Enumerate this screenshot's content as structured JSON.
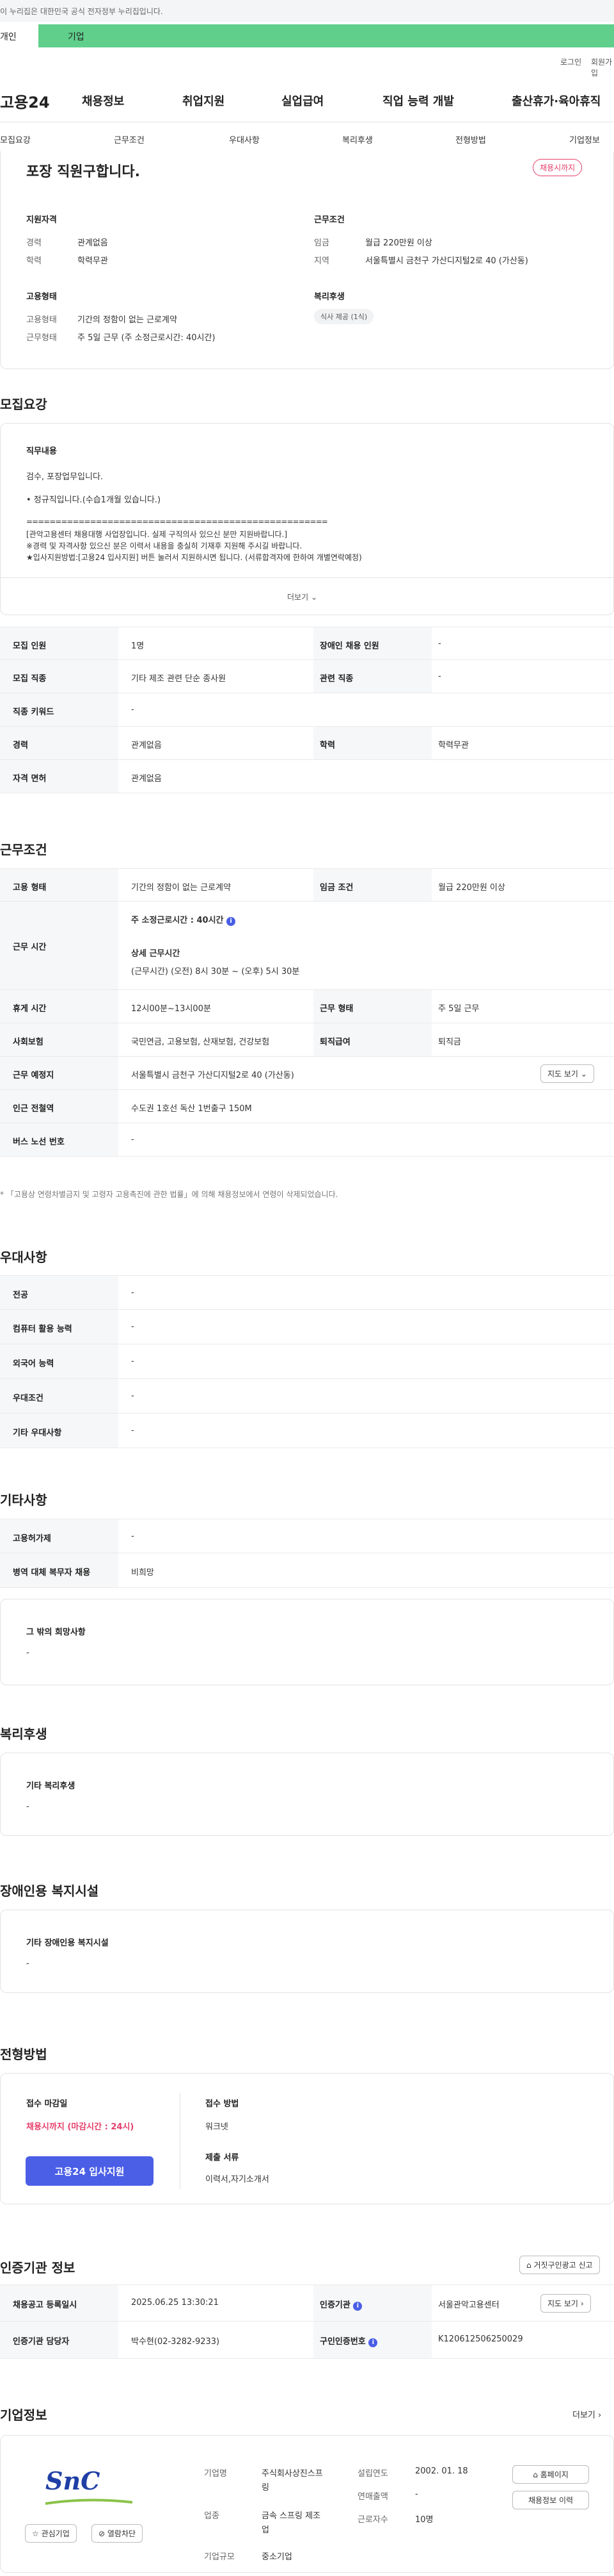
{
  "banner": {
    "text": "이 누리집은 대한민국 공식 전자정부 누리집입니다."
  },
  "user_tabs": {
    "individual": "개인",
    "business": "기업"
  },
  "util": {
    "login": "로그인",
    "join": "회원가입"
  },
  "gnb": {
    "logo": "고용24",
    "menu": [
      "채용정보",
      "취업지원",
      "실업급여",
      "직업 능력 개발",
      "출산휴가·육아휴직"
    ]
  },
  "subnav": [
    "모집요강",
    "근무조건",
    "우대사항",
    "복리후생",
    "전형방법",
    "기업정보"
  ],
  "summary": {
    "title": "포장 직원구합니다.",
    "status_badge": "채용시까지",
    "qual_title": "지원자격",
    "career_label": "경력",
    "career_value": "관계없음",
    "edu_label": "학력",
    "edu_value": "학력무관",
    "cond_title": "근무조건",
    "wage_label": "임금",
    "wage_value": "월급 220만원 이상",
    "region_label": "지역",
    "region_value": "서울특별시 금천구 가산디지털2로 40 (가산동)",
    "emp_title": "고용형태",
    "emp_label": "고용형태",
    "emp_value": "기간의 정함이 없는 근로계약",
    "worktype_label": "근무형태",
    "worktype_value": "주 5일 근무 (주 소정근로시간: 40시간)",
    "welfare_title": "복리후생",
    "welfare_pill": "식사 제공 (1식)"
  },
  "recruit": {
    "section_title": "모집요강",
    "duty_title": "직무내용",
    "duty_lines": [
      "검수, 포장업무입니다.",
      "• 정규직입니다.(수습1개월 있습니다.)",
      "====================================================",
      "[관악고용센터 채용대행 사업장입니다. 실제 구직의사 있으신 분만 지원바랍니다.]",
      "※경력 및 자격사항 있으신 분은  이력서 내용을 충실히 기재후 지원해 주시길 바랍니다.",
      "★입사지원방법:[고용24 입사지원] 버튼 눌러서 지원하시면 됩니다. (서류합격자에 한하여 개별연락예정)"
    ],
    "more": "더보기",
    "rows": [
      [
        {
          "k": "모집 인원",
          "v": "1명"
        },
        {
          "k": "장애인 채용 인원",
          "v": "-"
        }
      ],
      [
        {
          "k": "모집 직종",
          "v": "기타 제조 관련 단순 종사원"
        },
        {
          "k": "관련 직종",
          "v": "-"
        }
      ],
      [
        {
          "k": "직종 키워드",
          "v": "-"
        }
      ],
      [
        {
          "k": "경력",
          "v": "관계없음"
        },
        {
          "k": "학력",
          "v": "학력무관"
        }
      ],
      [
        {
          "k": "자격 면허",
          "v": "관계없음"
        }
      ]
    ]
  },
  "work": {
    "section_title": "근무조건",
    "emp_k": "고용 형태",
    "emp_v": "기간의 정함이 없는 근로계약",
    "wage_k": "임금 조건",
    "wage_v": "월급 220만원 이상",
    "time_k": "근무 시간",
    "time_main": "주 소정근로시간 : 40시간",
    "time_detail_title": "상세 근무시간",
    "time_detail": "(근무시간) (오전) 8시 30분 ~ (오후) 5시 30분",
    "rest_k": "휴게 시간",
    "rest_v": "12시00분~13시00분",
    "form_k": "근무 형태",
    "form_v": "주 5일 근무",
    "ins_k": "사회보험",
    "ins_v": "국민연금, 고용보험, 산재보험, 건강보험",
    "ret_k": "퇴직급여",
    "ret_v": "퇴직금",
    "place_k": "근무 예정지",
    "place_v": "서울특별시 금천구 가산디지털2로 40 (가산동)",
    "map_btn": "지도 보기",
    "subway_k": "인근 전철역",
    "subway_v": "수도권 1호선 독산 1번출구 150M",
    "bus_k": "버스 노선 번호",
    "bus_v": "-",
    "note": "* 「고용상 연령차별금지 및 고령자 고용촉진에 관한 법률」에 의해 채용정보에서 연령이 삭제되었습니다."
  },
  "pref": {
    "section_title": "우대사항",
    "rows": [
      {
        "k": "전공",
        "v": "-"
      },
      {
        "k": "컴퓨터 활용 능력",
        "v": "-"
      },
      {
        "k": "외국어 능력",
        "v": "-"
      },
      {
        "k": "우대조건",
        "v": "-"
      },
      {
        "k": "기타 우대사항",
        "v": "-"
      }
    ]
  },
  "etc": {
    "section_title": "기타사항",
    "rows": [
      {
        "k": "고용허가제",
        "v": "-"
      },
      {
        "k": "병역 대체 복무자 채용",
        "v": "비희망"
      }
    ],
    "wish_title": "그 밖의 희망사항",
    "wish_value": "-"
  },
  "welfare": {
    "section_title": "복리후생",
    "box_title": "기타 복리후생",
    "box_value": "-"
  },
  "disabled": {
    "section_title": "장애인용 복지시설",
    "box_title": "기타 장애인용 복지시설",
    "box_value": "-"
  },
  "screening": {
    "section_title": "전형방법",
    "deadline_label": "접수 마감일",
    "deadline_value": "채용시까지 (마감시간 : 24시)",
    "apply_btn": "고용24 입사지원",
    "method_label": "접수 방법",
    "method_value": "워크넷",
    "docs_label": "제출 서류",
    "docs_value": "이력서,자기소개서"
  },
  "cert": {
    "section_title": "인증기관 정보",
    "report_btn": "거짓구인광고 신고",
    "reg_k": "채용공고 등록일시",
    "reg_v": "2025.06.25 13:30:21",
    "org_k": "인증기관",
    "org_v": "서울관악고용센터",
    "map_btn": "지도 보기",
    "mgr_k": "인증기관 담당자",
    "mgr_v": "박수현(02-3282-9233)",
    "no_k": "구인인증번호",
    "no_v": "K120612506250029"
  },
  "company": {
    "section_title": "기업정보",
    "more": "더보기",
    "logo_text": "SnC",
    "fav_btn": "관심기업",
    "block_btn": "열람차단",
    "name_k": "기업명",
    "name_v1": "주식회사상진스프",
    "name_v2": "링",
    "ind_k": "업종",
    "ind_v1": "금속 스프링 제조",
    "ind_v2": "업",
    "size_k": "기업규모",
    "size_v": "중소기업",
    "est_k": "설립연도",
    "est_v": "2002. 01. 18",
    "sales_k": "연매출액",
    "sales_v": "-",
    "emp_k": "근로자수",
    "emp_v": "10명",
    "home_btn": "홈페이지",
    "jobs_btn": "채용정보 이력"
  },
  "colors": {
    "accent_green": "#5fcf8b",
    "apply_blue": "#4a5ee6",
    "deadline_red": "#e53e6a"
  }
}
